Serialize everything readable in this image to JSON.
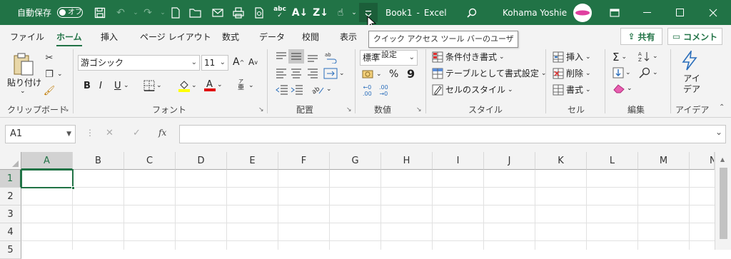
{
  "titlebar": {
    "autosave_label": "自動保存",
    "autosave_state": "オフ",
    "book_name": "Book1",
    "dash": "-",
    "app_name": "Excel",
    "user_name": "Kohama Yoshie"
  },
  "tooltip": "クイック アクセス ツール バーのユーザー設定",
  "tabs": [
    "ファイル",
    "ホーム",
    "挿入",
    "ページ レイアウト",
    "数式",
    "データ",
    "校閲",
    "表示"
  ],
  "share": {
    "share_label": "共有",
    "comment_label": "コメント"
  },
  "clipboard": {
    "paste_label": "貼り付け",
    "group_label": "クリップボード"
  },
  "font": {
    "font_name": "游ゴシック",
    "font_size": "11",
    "bold": "B",
    "italic": "I",
    "underline": "U",
    "grow": "A",
    "shrink": "A",
    "phonetic": "亜",
    "group_label": "フォント"
  },
  "alignment": {
    "group_label": "配置"
  },
  "number": {
    "format": "標準",
    "percent": "%",
    "comma": "9",
    "inc_decimal": ".00",
    "dec_decimal": ".00",
    "group_label": "数値"
  },
  "styles": {
    "conditional": "条件付き書式",
    "table": "テーブルとして書式設定",
    "cell_styles": "セルのスタイル",
    "group_label": "スタイル"
  },
  "cells": {
    "insert": "挿入",
    "delete": "削除",
    "format": "書式",
    "group_label": "セル"
  },
  "editing": {
    "group_label": "編集"
  },
  "ideas": {
    "label_line1": "アイ",
    "label_line2": "デア",
    "group_label": "アイデア"
  },
  "namebox": "A1",
  "fx": "fx",
  "columns": [
    "A",
    "B",
    "C",
    "D",
    "E",
    "F",
    "G",
    "H",
    "I",
    "J",
    "K",
    "L",
    "M",
    "N"
  ],
  "rows": [
    "1",
    "2",
    "3",
    "4",
    "5"
  ],
  "colors": {
    "brand": "#217346",
    "font_color": "#e00000",
    "highlight": "#ffff00"
  }
}
